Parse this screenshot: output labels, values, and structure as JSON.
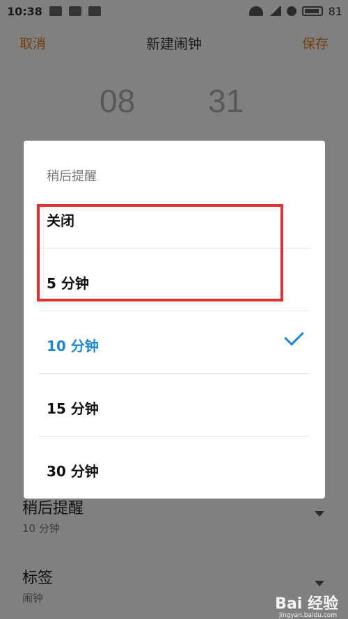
{
  "status_bar": {
    "time": "10:38",
    "battery": "81"
  },
  "titlebar": {
    "cancel": "取消",
    "title": "新建闹钟",
    "save": "保存"
  },
  "picker": {
    "hour": "08",
    "minute": "31"
  },
  "settings": {
    "snooze": {
      "title": "稍后提醒",
      "value": "10 分钟"
    },
    "label": {
      "title": "标签",
      "value": "闹钟"
    }
  },
  "dialog": {
    "title": "稍后提醒",
    "options": [
      {
        "label": "关闭",
        "selected": false
      },
      {
        "label": "5 分钟",
        "selected": false
      },
      {
        "label": "10 分钟",
        "selected": true
      },
      {
        "label": "15 分钟",
        "selected": false
      },
      {
        "label": "30 分钟",
        "selected": false
      }
    ]
  },
  "watermark": {
    "brand": "Bai 经验",
    "url": "jingyan.baidu.com"
  },
  "colors": {
    "accent": "#e0781e",
    "selected": "#1a87d0",
    "highlight": "#e03030"
  }
}
